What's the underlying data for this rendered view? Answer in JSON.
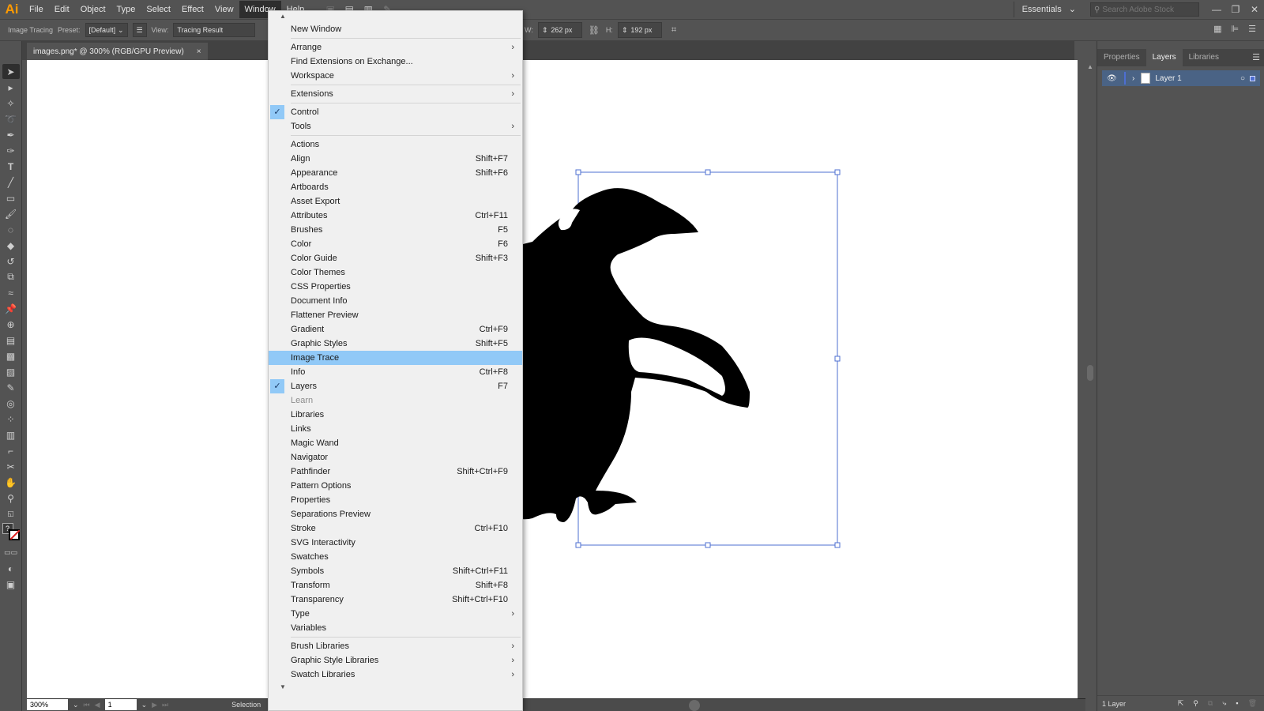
{
  "menubar": {
    "logo": "Ai",
    "items": [
      "File",
      "Edit",
      "Object",
      "Type",
      "Select",
      "Effect",
      "View",
      "Window",
      "Help"
    ],
    "open_item": "Window",
    "workspace": "Essentials",
    "search_placeholder": "Search Adobe Stock"
  },
  "controlbar": {
    "panel_name": "Image Tracing",
    "preset_label": "Preset:",
    "preset_value": "[Default]",
    "view_label": "View:",
    "view_value": "Tracing Result",
    "width_label": "W:",
    "width_value": "262 px",
    "height_label": "H:",
    "height_value": "192 px"
  },
  "document_tab": {
    "title": "images.png* @ 300% (RGB/GPU Preview)",
    "close": "×"
  },
  "statusbar": {
    "zoom": "300%",
    "artboard": "1",
    "tool": "Selection"
  },
  "layers_panel": {
    "tabs": [
      "Properties",
      "Layers",
      "Libraries"
    ],
    "active_tab": "Layers",
    "layers": [
      {
        "name": "Layer 1"
      }
    ],
    "footer": "1 Layer",
    "accent": "#4a6385"
  },
  "window_menu": {
    "highlight_color": "#91c9f7",
    "groups": [
      [
        {
          "label": "New Window"
        }
      ],
      [
        {
          "label": "Arrange",
          "submenu": true
        },
        {
          "label": "Find Extensions on Exchange..."
        },
        {
          "label": "Workspace",
          "submenu": true
        }
      ],
      [
        {
          "label": "Extensions",
          "submenu": true
        }
      ],
      [
        {
          "label": "Control",
          "checked": true
        },
        {
          "label": "Tools",
          "submenu": true
        }
      ],
      [
        {
          "label": "Actions"
        },
        {
          "label": "Align",
          "shortcut": "Shift+F7"
        },
        {
          "label": "Appearance",
          "shortcut": "Shift+F6"
        },
        {
          "label": "Artboards"
        },
        {
          "label": "Asset Export"
        },
        {
          "label": "Attributes",
          "shortcut": "Ctrl+F11"
        },
        {
          "label": "Brushes",
          "shortcut": "F5"
        },
        {
          "label": "Color",
          "shortcut": "F6"
        },
        {
          "label": "Color Guide",
          "shortcut": "Shift+F3"
        },
        {
          "label": "Color Themes"
        },
        {
          "label": "CSS Properties"
        },
        {
          "label": "Document Info"
        },
        {
          "label": "Flattener Preview"
        },
        {
          "label": "Gradient",
          "shortcut": "Ctrl+F9"
        },
        {
          "label": "Graphic Styles",
          "shortcut": "Shift+F5"
        },
        {
          "label": "Image Trace",
          "highlighted": true
        },
        {
          "label": "Info",
          "shortcut": "Ctrl+F8"
        },
        {
          "label": "Layers",
          "shortcut": "F7",
          "checked": true
        },
        {
          "label": "Learn",
          "disabled": true
        },
        {
          "label": "Libraries"
        },
        {
          "label": "Links"
        },
        {
          "label": "Magic Wand"
        },
        {
          "label": "Navigator"
        },
        {
          "label": "Pathfinder",
          "shortcut": "Shift+Ctrl+F9"
        },
        {
          "label": "Pattern Options"
        },
        {
          "label": "Properties"
        },
        {
          "label": "Separations Preview"
        },
        {
          "label": "Stroke",
          "shortcut": "Ctrl+F10"
        },
        {
          "label": "SVG Interactivity"
        },
        {
          "label": "Swatches"
        },
        {
          "label": "Symbols",
          "shortcut": "Shift+Ctrl+F11"
        },
        {
          "label": "Transform",
          "shortcut": "Shift+F8"
        },
        {
          "label": "Transparency",
          "shortcut": "Shift+Ctrl+F10"
        },
        {
          "label": "Type",
          "submenu": true
        },
        {
          "label": "Variables"
        }
      ],
      [
        {
          "label": "Brush Libraries",
          "submenu": true
        },
        {
          "label": "Graphic Style Libraries",
          "submenu": true
        },
        {
          "label": "Swatch Libraries",
          "submenu": true
        }
      ]
    ]
  },
  "icons": {
    "check": "✓",
    "submenu": "›",
    "scroll_up": "▲",
    "scroll_down": "▼",
    "dropdown": "⌄"
  },
  "tools": [
    "selection-tool",
    "direct-selection-tool",
    "magic-wand-tool",
    "lasso-tool",
    "pen-tool",
    "curvature-tool",
    "type-tool",
    "line-segment-tool",
    "rectangle-tool",
    "paintbrush-tool",
    "shaper-tool",
    "eraser-tool",
    "rotate-tool",
    "scale-tool",
    "width-tool",
    "puppet-warp-tool",
    "shape-builder-tool",
    "perspective-grid-tool",
    "mesh-tool",
    "gradient-tool",
    "eyedropper-tool",
    "blend-tool",
    "symbol-sprayer-tool",
    "column-graph-tool",
    "artboard-tool",
    "slice-tool",
    "hand-tool",
    "zoom-tool"
  ]
}
